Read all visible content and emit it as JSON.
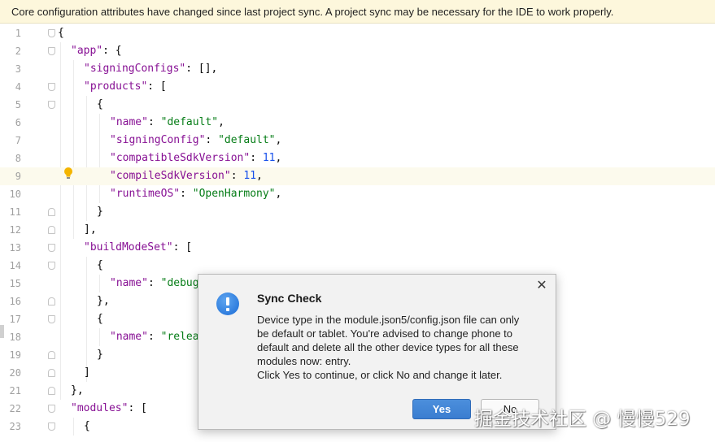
{
  "banner": {
    "text": "Core configuration attributes have changed since last project sync. A project sync may be necessary for the IDE to work properly."
  },
  "editor": {
    "current_line": 9,
    "lines": [
      {
        "n": "1",
        "indent": 0,
        "fold": "down",
        "tokens": [
          {
            "t": "p",
            "v": "{"
          }
        ]
      },
      {
        "n": "2",
        "indent": 1,
        "fold": "down",
        "tokens": [
          {
            "t": "k",
            "v": "\"app\""
          },
          {
            "t": "p",
            "v": ": {"
          }
        ]
      },
      {
        "n": "3",
        "indent": 2,
        "fold": "",
        "tokens": [
          {
            "t": "k",
            "v": "\"signingConfigs\""
          },
          {
            "t": "p",
            "v": ": [],"
          }
        ]
      },
      {
        "n": "4",
        "indent": 2,
        "fold": "down",
        "tokens": [
          {
            "t": "k",
            "v": "\"products\""
          },
          {
            "t": "p",
            "v": ": ["
          }
        ]
      },
      {
        "n": "5",
        "indent": 3,
        "fold": "down",
        "tokens": [
          {
            "t": "p",
            "v": "{"
          }
        ]
      },
      {
        "n": "6",
        "indent": 4,
        "fold": "",
        "tokens": [
          {
            "t": "k",
            "v": "\"name\""
          },
          {
            "t": "p",
            "v": ": "
          },
          {
            "t": "s",
            "v": "\"default\""
          },
          {
            "t": "p",
            "v": ","
          }
        ]
      },
      {
        "n": "7",
        "indent": 4,
        "fold": "",
        "tokens": [
          {
            "t": "k",
            "v": "\"signingConfig\""
          },
          {
            "t": "p",
            "v": ": "
          },
          {
            "t": "s",
            "v": "\"default\""
          },
          {
            "t": "p",
            "v": ","
          }
        ]
      },
      {
        "n": "8",
        "indent": 4,
        "fold": "",
        "tokens": [
          {
            "t": "k",
            "v": "\"compatibleSdkVersion\""
          },
          {
            "t": "p",
            "v": ": "
          },
          {
            "t": "n",
            "v": "11"
          },
          {
            "t": "p",
            "v": ","
          }
        ]
      },
      {
        "n": "9",
        "indent": 4,
        "fold": "",
        "tokens": [
          {
            "t": "k",
            "v": "\"compileSdkVersion\""
          },
          {
            "t": "p",
            "v": ": "
          },
          {
            "t": "n",
            "v": "11"
          },
          {
            "t": "p",
            "v": ","
          }
        ]
      },
      {
        "n": "10",
        "indent": 4,
        "fold": "",
        "tokens": [
          {
            "t": "k",
            "v": "\"runtimeOS\""
          },
          {
            "t": "p",
            "v": ": "
          },
          {
            "t": "s",
            "v": "\"OpenHarmony\""
          },
          {
            "t": "p",
            "v": ","
          }
        ]
      },
      {
        "n": "11",
        "indent": 3,
        "fold": "up",
        "tokens": [
          {
            "t": "p",
            "v": "}"
          }
        ]
      },
      {
        "n": "12",
        "indent": 2,
        "fold": "up",
        "tokens": [
          {
            "t": "p",
            "v": "],"
          }
        ]
      },
      {
        "n": "13",
        "indent": 2,
        "fold": "down",
        "tokens": [
          {
            "t": "k",
            "v": "\"buildModeSet\""
          },
          {
            "t": "p",
            "v": ": ["
          }
        ]
      },
      {
        "n": "14",
        "indent": 3,
        "fold": "down",
        "tokens": [
          {
            "t": "p",
            "v": "{"
          }
        ]
      },
      {
        "n": "15",
        "indent": 4,
        "fold": "",
        "tokens": [
          {
            "t": "k",
            "v": "\"name\""
          },
          {
            "t": "p",
            "v": ": "
          },
          {
            "t": "s",
            "v": "\"debug"
          }
        ]
      },
      {
        "n": "16",
        "indent": 3,
        "fold": "up",
        "tokens": [
          {
            "t": "p",
            "v": "},"
          }
        ]
      },
      {
        "n": "17",
        "indent": 3,
        "fold": "down",
        "tokens": [
          {
            "t": "p",
            "v": "{"
          }
        ]
      },
      {
        "n": "18",
        "indent": 4,
        "fold": "",
        "tokens": [
          {
            "t": "k",
            "v": "\"name\""
          },
          {
            "t": "p",
            "v": ": "
          },
          {
            "t": "s",
            "v": "\"relea"
          }
        ]
      },
      {
        "n": "19",
        "indent": 3,
        "fold": "up",
        "tokens": [
          {
            "t": "p",
            "v": "}"
          }
        ]
      },
      {
        "n": "20",
        "indent": 2,
        "fold": "up",
        "tokens": [
          {
            "t": "p",
            "v": "]"
          }
        ]
      },
      {
        "n": "21",
        "indent": 1,
        "fold": "up",
        "tokens": [
          {
            "t": "p",
            "v": "},"
          }
        ]
      },
      {
        "n": "22",
        "indent": 1,
        "fold": "down",
        "tokens": [
          {
            "t": "k",
            "v": "\"modules\""
          },
          {
            "t": "p",
            "v": ": ["
          }
        ]
      },
      {
        "n": "23",
        "indent": 2,
        "fold": "down",
        "tokens": [
          {
            "t": "p",
            "v": "{"
          }
        ]
      }
    ]
  },
  "dialog": {
    "title": "Sync Check",
    "message_lines": [
      "Device type in the module.json5/config.json file can only",
      "be default or tablet. You're advised to change phone to",
      "default and delete all the other device types for all these",
      "modules now: entry.",
      "Click Yes to continue, or click No and change it later."
    ],
    "yes_label": "Yes",
    "no_label": "No",
    "close_glyph": "✕"
  },
  "watermark": "掘金技术社区 @ 慢慢529",
  "colors": {
    "key": "#871094",
    "string": "#067d17",
    "number": "#1750eb",
    "accent_button": "#3a7dd0"
  },
  "icons": [
    "lightbulb-icon",
    "info-icon",
    "close-icon",
    "fold-icon"
  ]
}
